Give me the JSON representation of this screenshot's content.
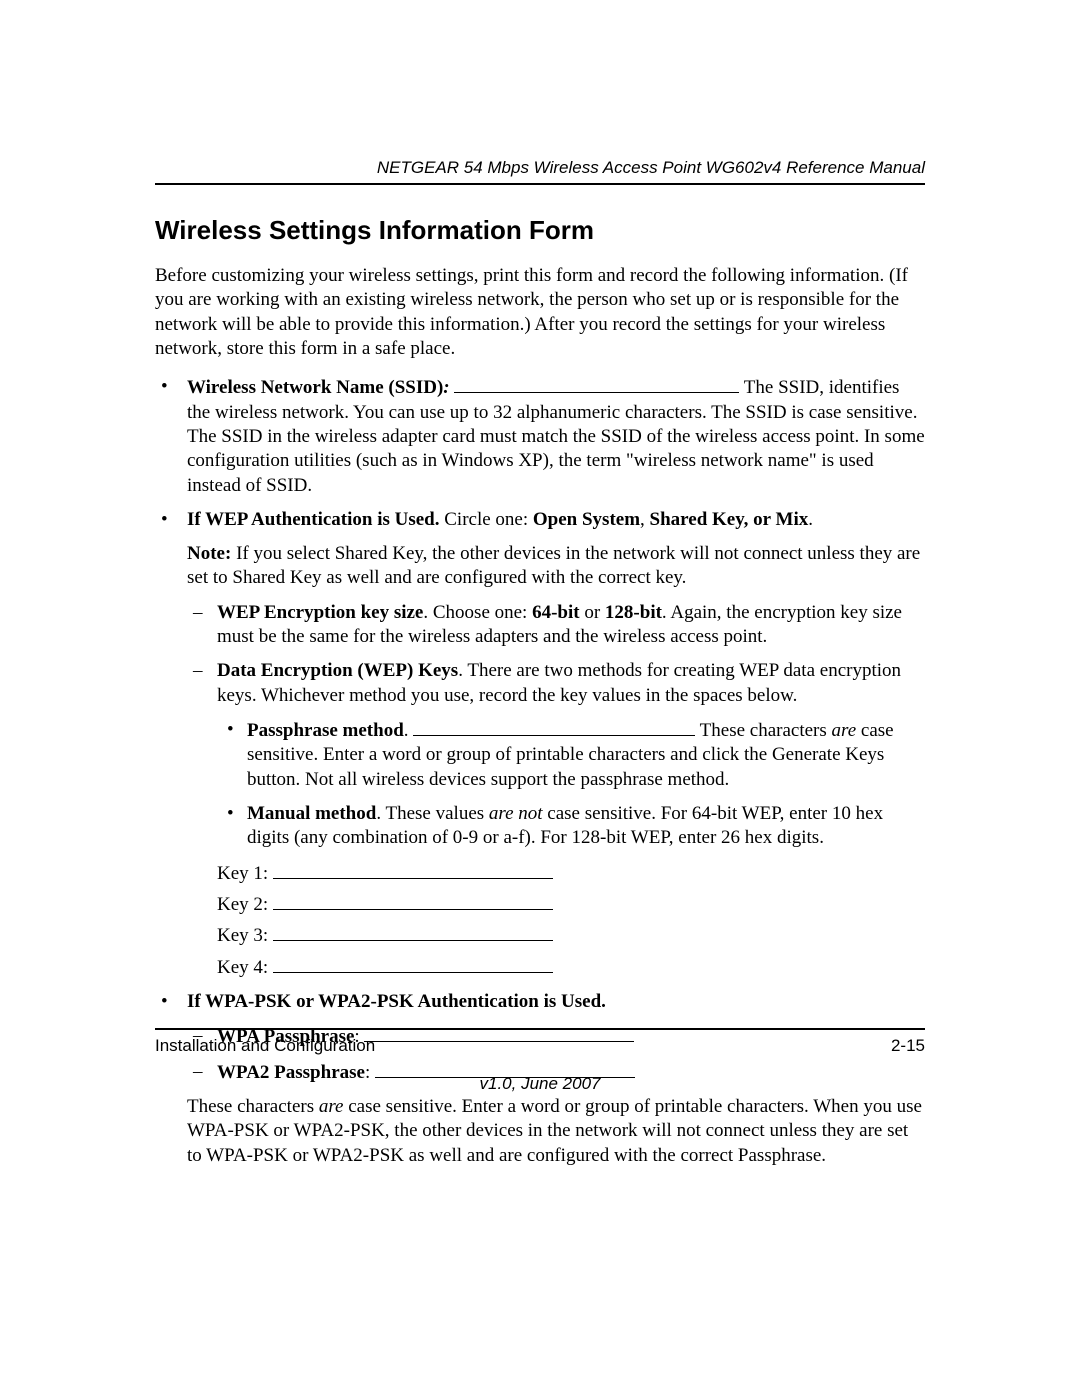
{
  "header": {
    "manual_title": "NETGEAR 54 Mbps Wireless Access Point WG602v4 Reference Manual"
  },
  "section": {
    "heading": "Wireless Settings Information Form",
    "intro": "Before customizing your wireless settings, print this form and record the following information. (If you are working with an existing wireless network, the person who set up or is responsible for the network will be able to provide this information.) After you record the settings for your wireless network, store this form in a safe place."
  },
  "ssid": {
    "label": "Wireless Network Name (SSID)",
    "colon": ":",
    "text": " The SSID, identifies the wireless network. You can use up to 32 alphanumeric characters. The SSID is case sensitive. The SSID in the wireless adapter card must match the SSID of the wireless access point. In some configuration utilities (such as in Windows XP), the term \"wireless network name\" is used instead of SSID."
  },
  "wep": {
    "heading_prefix": "If WEP Authentication is Used.",
    "heading_mid": " Circle one: ",
    "heading_choices": "Open System",
    "heading_sep1": ", ",
    "heading_choice2": "Shared Key, or Mix",
    "heading_period": ".",
    "note_label": "Note:",
    "note_text": " If you select Shared Key, the other devices in the network will not connect unless they are set to Shared Key as well and are configured with the correct key.",
    "keysize_label": "WEP Encryption key size",
    "keysize_text1": ". Choose one: ",
    "keysize_64": "64-bit",
    "keysize_or": " or ",
    "keysize_128": "128-bit",
    "keysize_text2": ". Again, the encryption key size must be the same for the wireless adapters and the wireless access point.",
    "datakeys_label": "Data Encryption (WEP) Keys",
    "datakeys_text": ". There are two methods for creating WEP data encryption keys. Whichever method you use, record the key values in the spaces below.",
    "passphrase_label": "Passphrase method",
    "passphrase_period": ". ",
    "passphrase_after1": " These characters ",
    "passphrase_are": "are",
    "passphrase_after2": " case sensitive. Enter a word or group of printable characters and click the Generate Keys button. Not all wireless devices support the passphrase method.",
    "manual_label": "Manual method",
    "manual_text1": ". These values ",
    "manual_arenot": "are not",
    "manual_text2": " case sensitive. For 64-bit WEP, enter 10 hex digits (any combination of 0-9 or a-f). For 128-bit WEP, enter 26 hex digits.",
    "key1_label": "Key 1: ",
    "key2_label": "Key 2: ",
    "key3_label": "Key 3: ",
    "key4_label": "Key 4: "
  },
  "wpa": {
    "heading": "If WPA-PSK or WPA2-PSK Authentication is Used.",
    "wpa_label": "WPA Passphrase",
    "wpa2_label": "WPA2 Passphrase",
    "colon": ": ",
    "tail_text1": "These characters ",
    "tail_are": "are",
    "tail_text2": " case sensitive. Enter a word or group of printable characters. When you use WPA-PSK or WPA2-PSK, the other devices in the network will not connect unless they are set to WPA-PSK or WPA2-PSK as well and are configured with the correct Passphrase."
  },
  "footer": {
    "left": "Installation and Configuration",
    "right": "2-15",
    "version": "v1.0, June 2007"
  }
}
